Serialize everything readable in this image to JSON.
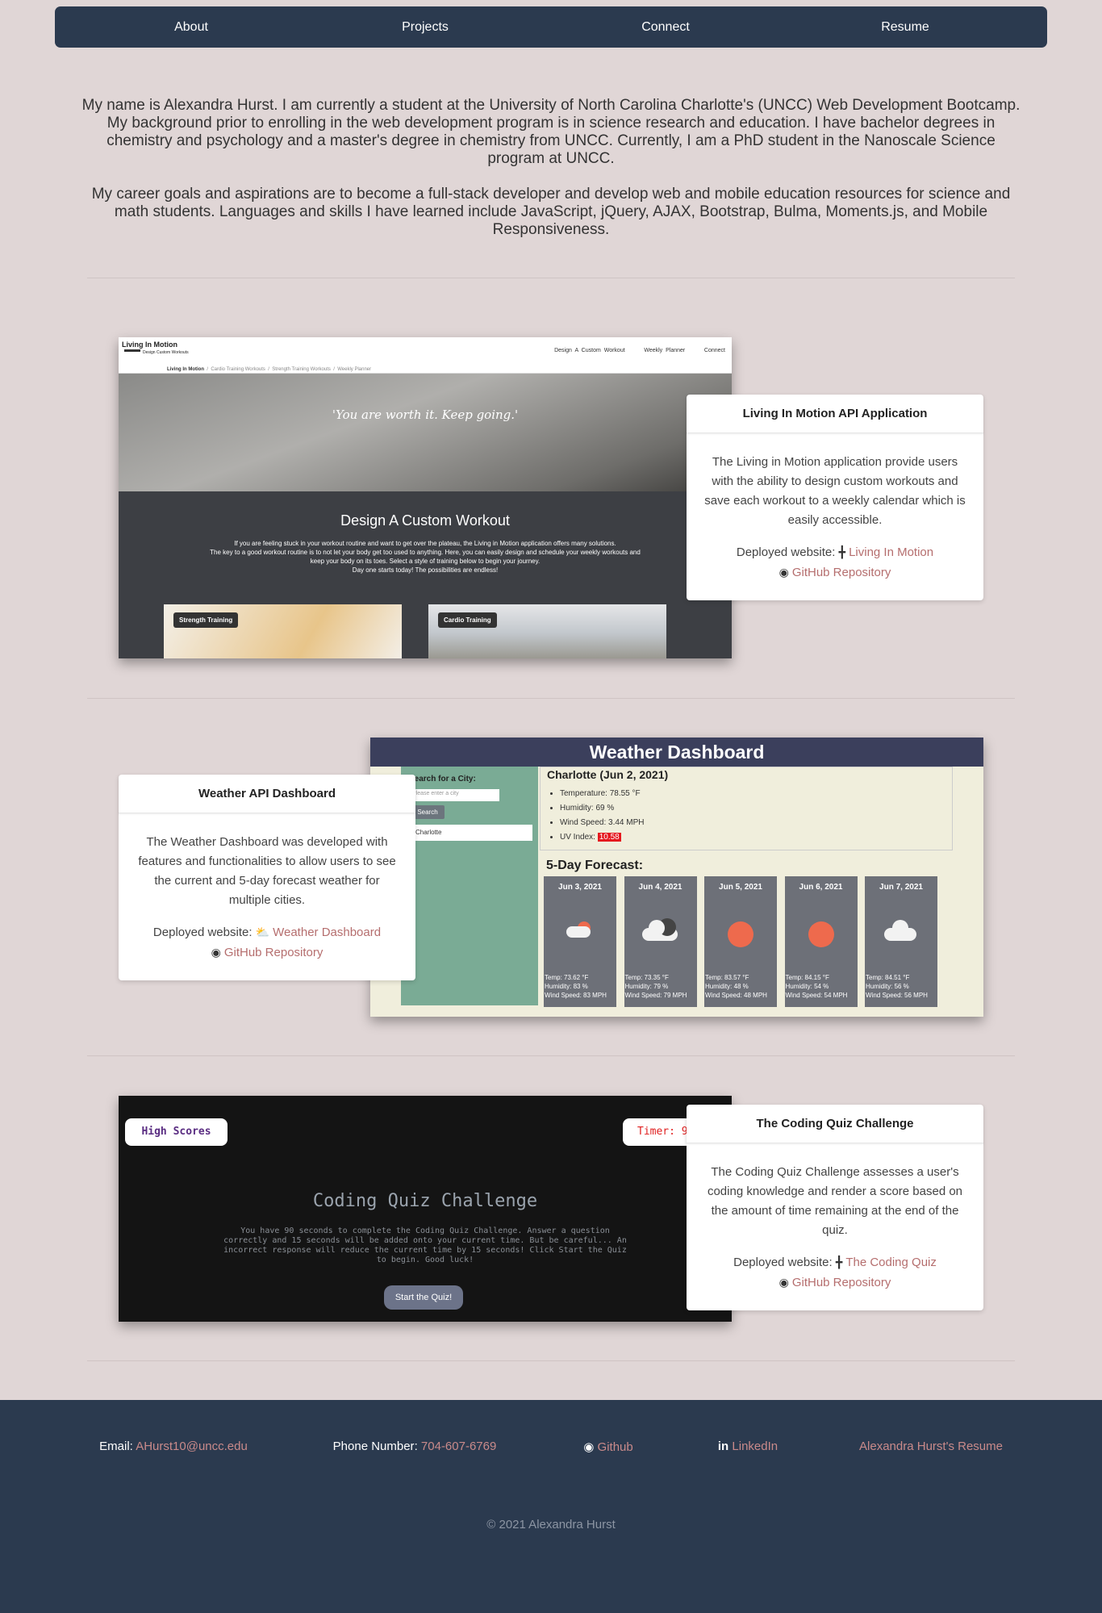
{
  "nav": {
    "about": "About",
    "projects": "Projects",
    "connect": "Connect",
    "resume": "Resume"
  },
  "intro": {
    "p1": "My name is Alexandra Hurst. I am currently a student at the University of North Carolina Charlotte's (UNCC) Web Development Bootcamp. My background prior to enrolling in the web development program is in science research and education. I have bachelor degrees in chemistry and psychology and a master's degree in chemistry from UNCC. Currently, I am a PhD student in the Nanoscale Science program at UNCC.",
    "p2": "My career goals and aspirations are to become a full-stack developer and develop web and mobile education resources for science and math students. Languages and skills I have learned include JavaScript, jQuery, AJAX, Bootstrap, Bulma, Moments.js, and Mobile Responsiveness."
  },
  "projects": [
    {
      "title": "Living In Motion API Application",
      "desc": "The Living in Motion application provide users with the ability to design custom workouts and save each workout to a weekly calendar which is easily accessible.",
      "deployed_label": "Deployed website:",
      "deployed_link": "Living In Motion",
      "repo_link": "GitHub Repository",
      "icon": "dumbbell-icon",
      "shot": {
        "logo": "Living In Motion",
        "logo_sub": "Design Custom Workouts",
        "nav": [
          "Design A Custom Workout",
          "Weekly Planner",
          "Connect"
        ],
        "crumbs": [
          "Living In Motion",
          "Cardio Training Workouts",
          "Strength Training Workouts",
          "Weekly Planner"
        ],
        "quote": "'You are worth it. Keep going.'",
        "heading": "Design A Custom Workout",
        "text1": "If you are feeling stuck in your workout routine and want to get over the plateau, the Living in Motion application offers many solutions.",
        "text2": "The key to a good workout routine is to not let your body get too used to anything. Here, you can easily design and schedule your weekly workouts and",
        "text3": "keep your body on its toes. Select a style of training below to begin your journey.",
        "text4": "Day one starts today! The possibilities are endless!",
        "tile1": "Strength Training",
        "tile2": "Cardio Training"
      }
    },
    {
      "title": "Weather API Dashboard",
      "desc": "The Weather Dashboard was developed with features and functionalities to allow users to see the current and 5-day forecast weather for multiple cities.",
      "deployed_label": "Deployed website:",
      "deployed_link": "Weather Dashboard",
      "repo_link": "GitHub Repository",
      "icon": "cloud-sun-icon",
      "shot": {
        "header": "Weather Dashboard",
        "search_label": "Search for a City:",
        "search_placeholder": "Please enter a city",
        "search_button": "Search",
        "history": "Charlotte",
        "city": "Charlotte (Jun 2, 2021)",
        "temp": "Temperature: 78.55 °F",
        "humidity": "Humidity: 69 %",
        "wind": "Wind Speed: 3.44 MPH",
        "uv_label": "UV Index:",
        "uv_value": "10.58",
        "forecast_title": "5-Day Forecast:",
        "forecast": [
          {
            "date": "Jun 3, 2021",
            "temp": "Temp: 73.62 °F",
            "hum": "Humidity: 83 %",
            "wind": "Wind Speed: 83 MPH",
            "icon": "rain-sun"
          },
          {
            "date": "Jun 4, 2021",
            "temp": "Temp: 73.35 °F",
            "hum": "Humidity: 79 %",
            "wind": "Wind Speed: 79 MPH",
            "icon": "clouds"
          },
          {
            "date": "Jun 5, 2021",
            "temp": "Temp: 83.57 °F",
            "hum": "Humidity: 48 %",
            "wind": "Wind Speed: 48 MPH",
            "icon": "sun"
          },
          {
            "date": "Jun 6, 2021",
            "temp": "Temp: 84.15 °F",
            "hum": "Humidity: 54 %",
            "wind": "Wind Speed: 54 MPH",
            "icon": "sun"
          },
          {
            "date": "Jun 7, 2021",
            "temp": "Temp: 84.51 °F",
            "hum": "Humidity: 56 %",
            "wind": "Wind Speed: 56 MPH",
            "icon": "cloud"
          }
        ]
      }
    },
    {
      "title": "The Coding Quiz Challenge",
      "desc": "The Coding Quiz Challenge assesses a user's coding knowledge and render a score based on the amount of time remaining at the end of the quiz.",
      "deployed_label": "Deployed website:",
      "deployed_link": "The Coding Quiz",
      "repo_link": "GitHub Repository",
      "icon": "dumbbell-icon",
      "shot": {
        "high_scores": "High Scores",
        "timer": "Timer: 9",
        "heading": "Coding Quiz Challenge",
        "text": "You have 90 seconds to complete the Coding Quiz Challenge. Answer a question correctly and 15 seconds will be added onto your current time. But be careful... An incorrect response will reduce the current time by 15 seconds! Click Start the Quiz to begin. Good luck!",
        "button": "Start the Quiz!"
      }
    }
  ],
  "footer": {
    "email_label": "Email",
    "email": "AHurst10@uncc.edu",
    "phone_label": "Phone Number",
    "phone": "704-607-6769",
    "github": "Github",
    "linkedin": "LinkedIn",
    "resume": "Alexandra Hurst's Resume",
    "copyright": "© 2021 Alexandra Hurst"
  },
  "colors": {
    "background": "#e0d6d6",
    "navy": "#2b3a4f",
    "link": "#b56e6e"
  }
}
